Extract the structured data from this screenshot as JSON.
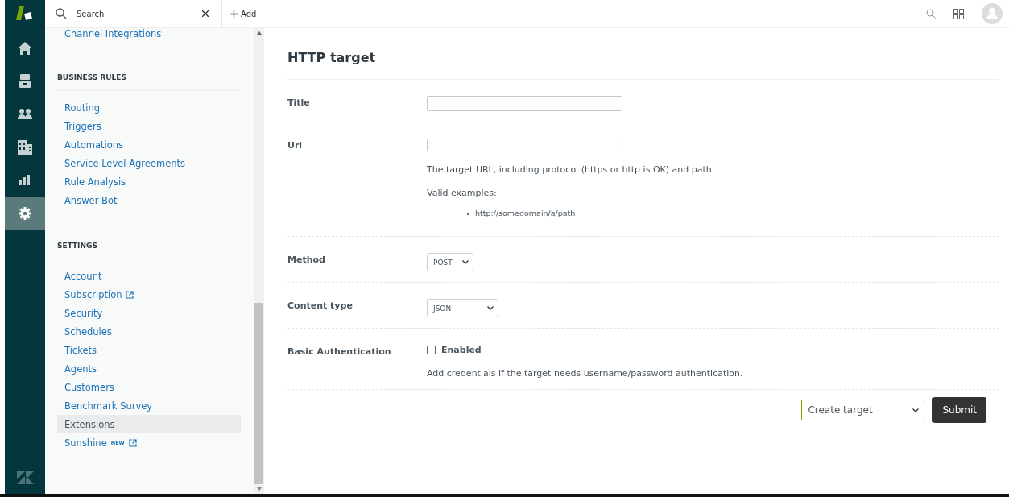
{
  "rail": {
    "items": [
      {
        "selected": false
      },
      {
        "selected": false
      },
      {
        "selected": false
      },
      {
        "selected": false
      },
      {
        "selected": false
      },
      {
        "selected": true
      }
    ]
  },
  "topbar": {
    "search": {
      "placeholder": "Search"
    },
    "add_label": "Add"
  },
  "sidebar": {
    "items": [
      {
        "kind": "link",
        "label": "Channel Integrations",
        "selected": false
      },
      {
        "kind": "header",
        "label": "BUSINESS RULES"
      },
      {
        "kind": "link",
        "label": "Routing",
        "selected": false
      },
      {
        "kind": "link",
        "label": "Triggers",
        "selected": false
      },
      {
        "kind": "link",
        "label": "Automations",
        "selected": false
      },
      {
        "kind": "link",
        "label": "Service Level Agreements",
        "selected": false
      },
      {
        "kind": "link",
        "label": "Rule Analysis",
        "selected": false
      },
      {
        "kind": "link",
        "label": "Answer Bot",
        "selected": false
      },
      {
        "kind": "header",
        "label": "SETTINGS"
      },
      {
        "kind": "link",
        "label": "Account",
        "selected": false
      },
      {
        "kind": "link",
        "label": "Subscription",
        "selected": false,
        "external": true
      },
      {
        "kind": "link",
        "label": "Security",
        "selected": false
      },
      {
        "kind": "link",
        "label": "Schedules",
        "selected": false
      },
      {
        "kind": "link",
        "label": "Tickets",
        "selected": false
      },
      {
        "kind": "link",
        "label": "Agents",
        "selected": false
      },
      {
        "kind": "link",
        "label": "Customers",
        "selected": false
      },
      {
        "kind": "link",
        "label": "Benchmark Survey",
        "selected": false
      },
      {
        "kind": "link",
        "label": "Extensions",
        "selected": true
      },
      {
        "kind": "link",
        "label": "Sunshine",
        "selected": false,
        "badge": "NEW",
        "external": true
      }
    ]
  },
  "form": {
    "title": "HTTP target",
    "rows": [
      {
        "kind": "text",
        "label": "Title"
      },
      {
        "kind": "text",
        "label": "Url",
        "help": "The target URL, including protocol (https or http is OK) and path.",
        "examples_label": "Valid examples:",
        "examples": [
          "http://somedomain/a/path"
        ]
      },
      {
        "kind": "select",
        "label": "Method",
        "value": "POST"
      },
      {
        "kind": "select",
        "label": "Content type",
        "value": "JSON"
      },
      {
        "kind": "checkbox",
        "label": "Basic Authentication",
        "option": "Enabled",
        "checked": false,
        "help": "Add credentials if the target needs username/password authentication."
      }
    ],
    "action_select": "Create target",
    "submit": "Submit"
  }
}
